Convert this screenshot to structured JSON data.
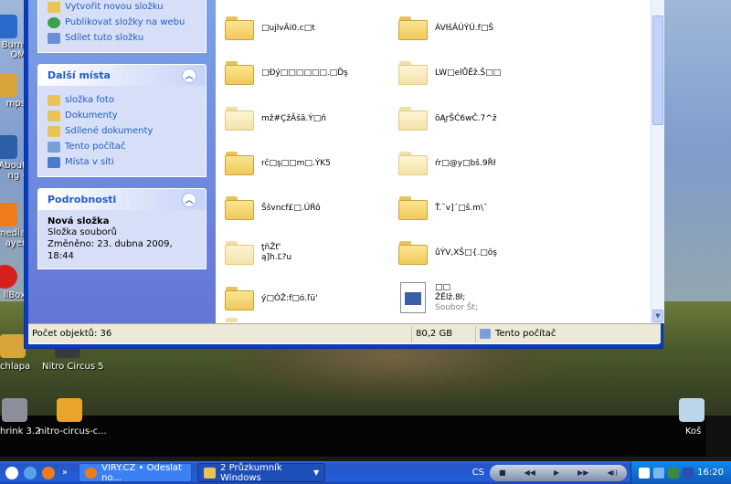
{
  "desktop": {
    "left_partial_labels": [
      "Burni",
      "OM",
      "mps",
      "About",
      "ng -",
      "media",
      "ayer",
      "llBox",
      "chlapa",
      "hrink 3.2"
    ],
    "bottom_icons": [
      {
        "label": "Nitro Circus 5"
      },
      {
        "label": "nitro-circus-c..."
      }
    ],
    "recycle_bin": "Koš"
  },
  "window": {
    "tasks_top": [
      {
        "label": "Vytvořit novou složku",
        "icon": "new-folder-icon"
      },
      {
        "label": "Publikovat složky na webu",
        "icon": "globe-icon"
      },
      {
        "label": "Sdílet tuto složku",
        "icon": "share-icon"
      }
    ],
    "other_places": {
      "title": "Další místa",
      "items": [
        {
          "label": "složka foto",
          "icon": "folder-icon"
        },
        {
          "label": "Dokumenty",
          "icon": "folder-icon"
        },
        {
          "label": "Sdílené dokumenty",
          "icon": "folder-icon"
        },
        {
          "label": "Tento počítač",
          "icon": "computer-icon"
        },
        {
          "label": "Místa v síti",
          "icon": "network-icon"
        }
      ]
    },
    "details": {
      "title": "Podrobnosti",
      "name": "Nová složka",
      "type": "Složka souborů",
      "modified": "Změněno: 23. dubna 2009, 18:44"
    },
    "files_left": [
      {
        "name": "□ujlvÂi0.c□t",
        "pale": false
      },
      {
        "name": "□Ðý□□□□□□.□Ďş",
        "pale": false
      },
      {
        "name": "mž#ÇžÃšã.Ý□ň",
        "pale": true
      },
      {
        "name": "rč□ş□□m□.ÝK5",
        "pale": false
      },
      {
        "name": "Ššvncf£□.ÚŔô",
        "pale": false
      },
      {
        "name": "ţňŽť'",
        "name2": "ą]h.Ľ?u",
        "pale": true
      },
      {
        "name": "ý□ÓŽ:f□ó.ľü'",
        "pale": false
      }
    ],
    "files_right": [
      {
        "name": "ÁVłšÂÚÝÚ.f□Š",
        "pale": false
      },
      {
        "name": "LW□elŮĚž.Š□□",
        "pale": true
      },
      {
        "name": "õĄŗŠĆ6wČ.7^ž",
        "pale": true
      },
      {
        "name": "ŕr□@y□bš.9Řł",
        "pale": true
      },
      {
        "name": "Ť.˘v]´□š.m\\˘",
        "pale": false
      },
      {
        "name": "ůÝV,XŠ□{.□ôş",
        "pale": false
      },
      {
        "name": "□□",
        "name2": "ŽËlž.8ł;",
        "sub": "Soubor Št;",
        "doc": true
      }
    ],
    "status": {
      "count": "Počet objektů: 36",
      "size": "80,2 GB",
      "location": "Tento počítač"
    }
  },
  "taskbar": {
    "buttons": [
      {
        "label": "VIRY.CZ • Odeslat no...",
        "active": false
      },
      {
        "label": "2 Průzkumník Windows",
        "active": true
      }
    ],
    "lang": "CS",
    "clock": "16:20"
  },
  "colors": {
    "xp_blue": "#0a3cbc",
    "taskpane_link": "#215dc6",
    "taskbar_blue": "#245edb"
  }
}
